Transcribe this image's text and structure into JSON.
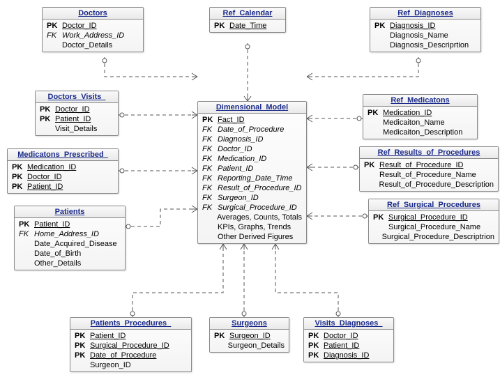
{
  "entities": {
    "doctors": {
      "title": "Doctors",
      "rows": [
        {
          "key": "PK",
          "name": "Doctor_ID",
          "kind": "pk"
        },
        {
          "key": "FK",
          "name": "Work_Address_ID",
          "kind": "fk"
        },
        {
          "key": "",
          "name": "Doctor_Details",
          "kind": "plain"
        }
      ]
    },
    "ref_calendar": {
      "title": "Ref_Calendar",
      "rows": [
        {
          "key": "PK",
          "name": "Date_Time",
          "kind": "pk"
        }
      ]
    },
    "ref_diagnoses": {
      "title": "Ref_Diagnoses",
      "rows": [
        {
          "key": "PK",
          "name": "Diagnosis_ID",
          "kind": "pk"
        },
        {
          "key": "",
          "name": "Diagnosis_Name",
          "kind": "plain"
        },
        {
          "key": "",
          "name": "Diagnosis_Descriprtion",
          "kind": "plain"
        }
      ]
    },
    "doctors_visits": {
      "title": "Doctors_Visits_",
      "rows": [
        {
          "key": "PK",
          "name": "Doctor_ID",
          "kind": "pk"
        },
        {
          "key": "PK",
          "name": "Patient_ID",
          "kind": "pk"
        },
        {
          "key": "",
          "name": "Visit_Details",
          "kind": "plain"
        }
      ]
    },
    "dimensional_model": {
      "title": "Dimensional_Model",
      "rows": [
        {
          "key": "PK",
          "name": "Fact_ID",
          "kind": "pk"
        },
        {
          "key": "FK",
          "name": "Date_of_Procedure",
          "kind": "fk"
        },
        {
          "key": "FK",
          "name": "Diagnosis_ID",
          "kind": "fk"
        },
        {
          "key": "FK",
          "name": "Doctor_ID",
          "kind": "fk"
        },
        {
          "key": "FK",
          "name": "Medication_ID",
          "kind": "fk"
        },
        {
          "key": "FK",
          "name": "Patient_ID",
          "kind": "fk"
        },
        {
          "key": "FK",
          "name": "Reporting_Date_Time",
          "kind": "fk"
        },
        {
          "key": "FK",
          "name": "Result_of_Procedure_ID",
          "kind": "fk"
        },
        {
          "key": "FK",
          "name": "Surgeon_ID",
          "kind": "fk"
        },
        {
          "key": "FK",
          "name": "Surgical_Procedure_ID",
          "kind": "fk"
        },
        {
          "key": "",
          "name": "Averages, Counts, Totals",
          "kind": "plain"
        },
        {
          "key": "",
          "name": "KPIs, Graphs, Trends",
          "kind": "plain"
        },
        {
          "key": "",
          "name": "Other Derived Figures",
          "kind": "plain"
        }
      ]
    },
    "ref_medicatons": {
      "title": "Ref_Medicatons",
      "rows": [
        {
          "key": "PK",
          "name": "Medication_ID",
          "kind": "pk"
        },
        {
          "key": "",
          "name": "Medicaiton_Name",
          "kind": "plain"
        },
        {
          "key": "",
          "name": "Medicaiton_Description",
          "kind": "plain"
        }
      ]
    },
    "medicatons_prescribed": {
      "title": "Medicatons_Prescribed_",
      "rows": [
        {
          "key": "PK",
          "name": "Medication_ID",
          "kind": "pk"
        },
        {
          "key": "PK",
          "name": "Doctor_ID",
          "kind": "pk"
        },
        {
          "key": "PK",
          "name": "Patient_ID",
          "kind": "pk"
        }
      ]
    },
    "ref_results_of_procedures": {
      "title": "Ref_Results_of_Procedures",
      "rows": [
        {
          "key": "PK",
          "name": "Result_of_Procedure_ID",
          "kind": "pk"
        },
        {
          "key": "",
          "name": "Result_of_Procedure_Name",
          "kind": "plain"
        },
        {
          "key": "",
          "name": "Result_of_Procedure_Description",
          "kind": "plain"
        }
      ]
    },
    "patients": {
      "title": "Patients",
      "rows": [
        {
          "key": "PK",
          "name": "Patient_ID",
          "kind": "pk"
        },
        {
          "key": "FK",
          "name": "Home_Address_ID",
          "kind": "fk"
        },
        {
          "key": "",
          "name": "Date_Acquired_Disease",
          "kind": "plain"
        },
        {
          "key": "",
          "name": "Date_of_Birth",
          "kind": "plain"
        },
        {
          "key": "",
          "name": "Other_Details",
          "kind": "plain"
        }
      ]
    },
    "ref_surgical_procedures": {
      "title": "Ref_Surgical_Procedures",
      "rows": [
        {
          "key": "PK",
          "name": "Surgical_Procedure_ID",
          "kind": "pk"
        },
        {
          "key": "",
          "name": "Surgical_Procedure_Name",
          "kind": "plain"
        },
        {
          "key": "",
          "name": "Surgical_Procedure_Descriptrion",
          "kind": "plain"
        }
      ]
    },
    "patients_procedures": {
      "title": "Patients_Procedures_",
      "rows": [
        {
          "key": "PK",
          "name": "Patient_ID",
          "kind": "pk"
        },
        {
          "key": "PK",
          "name": "Surgical_Procedure_ID",
          "kind": "pk"
        },
        {
          "key": "PK",
          "name": "Date_of_Procedure",
          "kind": "pk"
        },
        {
          "key": "",
          "name": "Surgeon_ID",
          "kind": "plain"
        }
      ]
    },
    "surgeons": {
      "title": "Surgeons",
      "rows": [
        {
          "key": "PK",
          "name": "Surgeon_ID",
          "kind": "pk"
        },
        {
          "key": "",
          "name": "Surgeon_Details",
          "kind": "plain"
        }
      ]
    },
    "visits_diagnoses": {
      "title": "Visits_Diagnoses_",
      "rows": [
        {
          "key": "PK",
          "name": "Doctor_ID",
          "kind": "pk"
        },
        {
          "key": "PK",
          "name": "Patient_ID",
          "kind": "pk"
        },
        {
          "key": "PK",
          "name": "Diagnosis_ID",
          "kind": "pk"
        }
      ]
    }
  }
}
